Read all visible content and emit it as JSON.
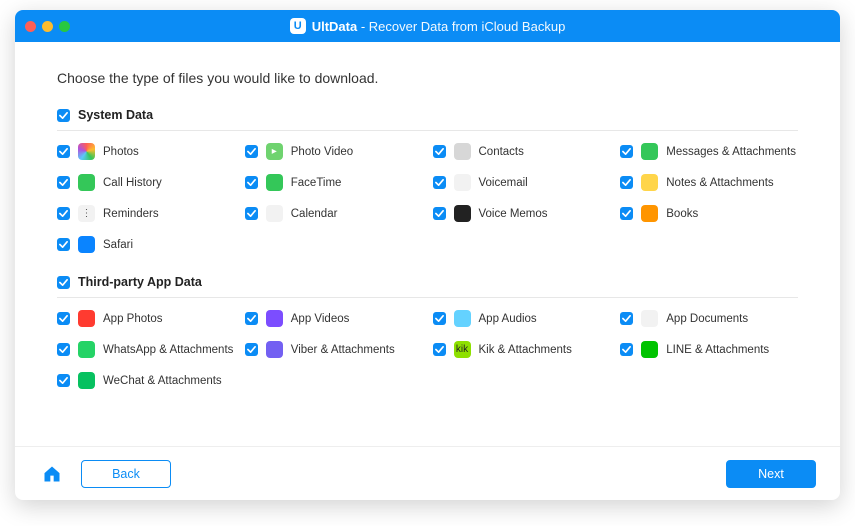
{
  "title": {
    "app": "UltData",
    "separator": " - ",
    "subtitle": "Recover Data from iCloud Backup"
  },
  "heading": "Choose the type of files you would like to download.",
  "sections": {
    "system": {
      "label": "System Data",
      "items": [
        {
          "label": "Photos",
          "icon_bg": "conic-gradient(#ff5f57,#febc2e,#34c759,#5ac8fa,#af52de,#ff5f57)",
          "icon_fg": "#fff",
          "glyph": ""
        },
        {
          "label": "Photo Video",
          "icon_bg": "#6fd36f",
          "glyph": "▸"
        },
        {
          "label": "Contacts",
          "icon_bg": "#d7d7d7",
          "glyph": ""
        },
        {
          "label": "Messages & Attachments",
          "icon_bg": "#34c759",
          "glyph": ""
        },
        {
          "label": "Call History",
          "icon_bg": "#34c759",
          "glyph": ""
        },
        {
          "label": "FaceTime",
          "icon_bg": "#34c759",
          "glyph": ""
        },
        {
          "label": "Voicemail",
          "icon_bg": "#f2f2f2",
          "icon_fg": "#555",
          "glyph": ""
        },
        {
          "label": "Notes & Attachments",
          "icon_bg": "#ffd54a",
          "glyph": ""
        },
        {
          "label": "Reminders",
          "icon_bg": "#f2f2f2",
          "icon_fg": "#555",
          "glyph": "⋮"
        },
        {
          "label": "Calendar",
          "icon_bg": "#f2f2f2",
          "icon_fg": "#555",
          "glyph": ""
        },
        {
          "label": "Voice Memos",
          "icon_bg": "#222",
          "glyph": ""
        },
        {
          "label": "Books",
          "icon_bg": "#ff9500",
          "glyph": ""
        },
        {
          "label": "Safari",
          "icon_bg": "#0a84ff",
          "glyph": ""
        }
      ]
    },
    "thirdparty": {
      "label": "Third-party App Data",
      "items": [
        {
          "label": "App Photos",
          "icon_bg": "#ff3b30",
          "glyph": ""
        },
        {
          "label": "App Videos",
          "icon_bg": "#7c4dff",
          "glyph": ""
        },
        {
          "label": "App Audios",
          "icon_bg": "#64d2ff",
          "glyph": ""
        },
        {
          "label": "App Documents",
          "icon_bg": "#f2f2f2",
          "icon_fg": "#555",
          "glyph": ""
        },
        {
          "label": "WhatsApp & Attachments",
          "icon_bg": "#25d366",
          "glyph": ""
        },
        {
          "label": "Viber & Attachments",
          "icon_bg": "#7360f2",
          "glyph": ""
        },
        {
          "label": "Kik & Attachments",
          "icon_bg": "#8ee000",
          "icon_fg": "#222",
          "glyph": "kik"
        },
        {
          "label": "LINE & Attachments",
          "icon_bg": "#00c300",
          "glyph": ""
        },
        {
          "label": "WeChat & Attachments",
          "icon_bg": "#07c160",
          "glyph": ""
        }
      ]
    }
  },
  "footer": {
    "back": "Back",
    "next": "Next"
  }
}
